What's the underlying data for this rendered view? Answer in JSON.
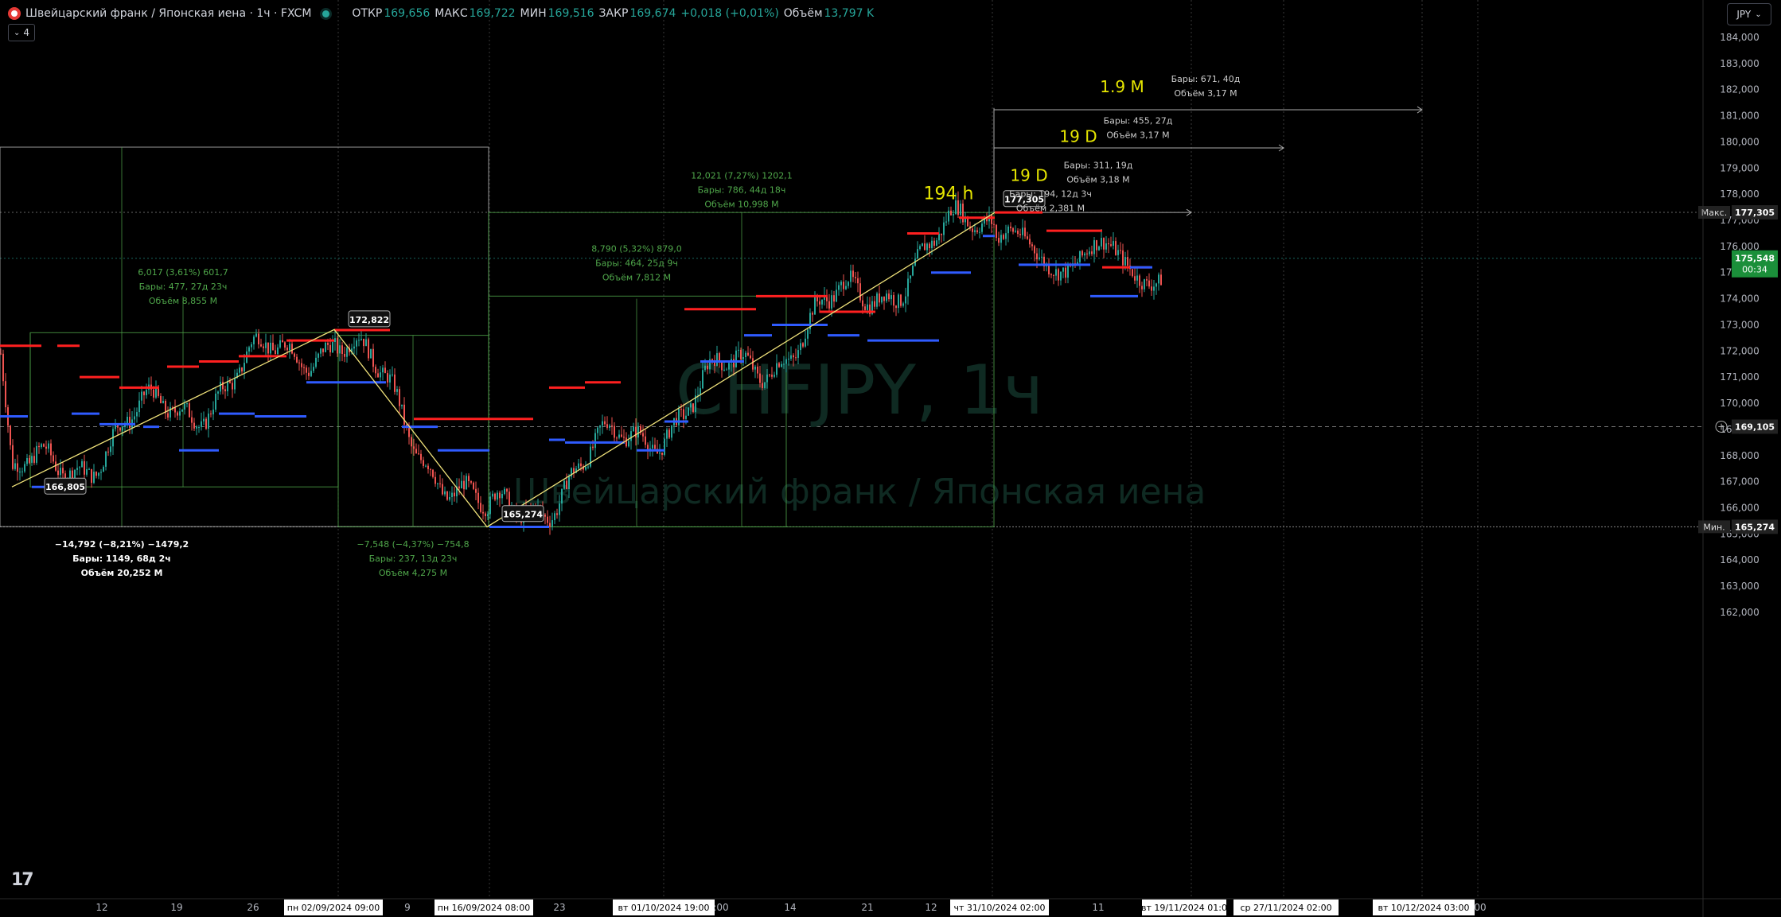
{
  "header": {
    "symbol_title": "Швейцарский франк / Японская иена · 1ч · FXCM",
    "open_label": "ОТКР",
    "open_value": "169,656",
    "high_label": "МАКС",
    "high_value": "169,722",
    "low_label": "МИН",
    "low_value": "169,516",
    "close_label": "ЗАКР",
    "close_value": "169,674",
    "change_value": "+0,018 (+0,01%)",
    "volume_label": "Объём",
    "volume_value": "13,797 K",
    "indicators_count": "4",
    "currency_button": "JPY"
  },
  "watermark": {
    "ticker": "CHFJPY, 1ч",
    "name": "Швейцарский франк / Японская иена"
  },
  "colors": {
    "bg": "#000000",
    "candle_up": "#26a69a",
    "candle_down": "#ef5350",
    "resistance": "#ff2020",
    "support": "#2f5bff",
    "trend": "#f0e27a",
    "ruler": "#6abf5a"
  },
  "chart_data": {
    "type": "candlestick",
    "ylim": [
      161.5,
      185.0
    ],
    "y_ticks": [
      "162,000",
      "163,000",
      "164,000",
      "165,000",
      "166,000",
      "167,000",
      "168,000",
      "169,000",
      "170,000",
      "171,000",
      "172,000",
      "173,000",
      "174,000",
      "175,000",
      "176,000",
      "177,000",
      "178,000",
      "179,000",
      "180,000",
      "181,000",
      "182,000",
      "183,000",
      "184,000"
    ],
    "x_ticks": [
      "12",
      "19",
      "26",
      "9",
      "23",
      "14",
      "21",
      "11"
    ],
    "time_labels": [
      "пн 02/09/2024   09:00",
      "пн 16/09/2024   08:00",
      "вт 01/10/2024   19:00",
      "чт 31/10/2024   02:00",
      "вт 19/11/2024   01:0",
      "ср 27/11/2024   02:00",
      "вт 10/12/2024   03:00"
    ],
    "time_label_fragments": [
      ":00",
      "00",
      "12"
    ],
    "price_tags": {
      "max": {
        "label": "Макс.",
        "value": "177,305"
      },
      "min": {
        "label": "Мин.",
        "value": "165,274"
      },
      "current": {
        "value": "175,548",
        "countdown": "00:34"
      },
      "crosshair": {
        "value": "169,105"
      }
    },
    "swing_points": [
      {
        "value": "166,805"
      },
      {
        "value": "172,822"
      },
      {
        "value": "165,274"
      },
      {
        "value": "177,305"
      }
    ],
    "trend_path": [
      {
        "t": 15,
        "p": 166.8
      },
      {
        "t": 420,
        "p": 172.82
      },
      {
        "t": 612,
        "p": 165.27
      },
      {
        "t": 1250,
        "p": 177.3
      }
    ],
    "measurements": [
      {
        "lines": [
          "6,017 (3,61%) 601,7",
          "Бары: 477, 27д 23ч",
          "Объём 8,855 M"
        ]
      },
      {
        "lines": [
          "−14,792 (−8,21%) −1479,2",
          "Бары: 1149, 68д 2ч",
          "Объём 20,252 M"
        ]
      },
      {
        "lines": [
          "−7,548 (−4,37%) −754,8",
          "Бары: 237, 13д 23ч",
          "Объём 4,275 M"
        ]
      },
      {
        "lines": [
          "8,790 (5,32%) 879,0",
          "Бары: 464, 25д 9ч",
          "Объём 7,812 M"
        ]
      },
      {
        "lines": [
          "12,021 (7,27%) 1202,1",
          "Бары: 786, 44д 18ч",
          "Объём 10,998 M"
        ]
      },
      {
        "lines": [
          "Бары: 194, 12д 3ч",
          "Объём 2,381 M"
        ]
      },
      {
        "lines": [
          "Бары: 311, 19д",
          "Объём 3,18 M"
        ]
      },
      {
        "lines": [
          "Бары: 455, 27д",
          "Объём 3,17 M"
        ]
      },
      {
        "lines": [
          "Бары: 671, 40д",
          "Объём 3,17 M"
        ]
      }
    ],
    "annotations": [
      "194 h",
      "19 D",
      "19 D",
      "1.9 M"
    ]
  }
}
